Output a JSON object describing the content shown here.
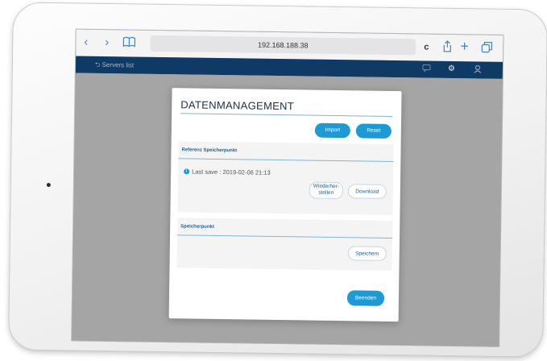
{
  "browser": {
    "back_icon": "‹",
    "forward_icon": "›",
    "bookmarks_icon": "book-icon",
    "url": "192.168.188.38",
    "reload_icon": "c",
    "share_icon": "share-icon",
    "new_tab_icon": "+",
    "tabs_icon": "tabs-icon"
  },
  "app_bar": {
    "back_label": "Servers list",
    "icons": [
      "chat-icon",
      "gear-icon",
      "user-icon"
    ]
  },
  "modal": {
    "title": "DATENMANAGEMENT",
    "import_label": "Import",
    "reset_label": "Reset",
    "reference": {
      "heading": "Referenz Speicherpunkt",
      "last_save": "Last save : 2019-02-06 21:13",
      "restore_line1": "Wiederher-",
      "restore_line2": "stellen",
      "download_label": "Download"
    },
    "savepoint": {
      "heading": "Speicherpunkt",
      "save_label": "Speichern"
    },
    "close_label": "Beenden"
  },
  "colors": {
    "accent": "#1b9ad6",
    "app_bar": "#0f3a66",
    "heading": "#1b5f94",
    "overlay": "#a5a5a5"
  }
}
